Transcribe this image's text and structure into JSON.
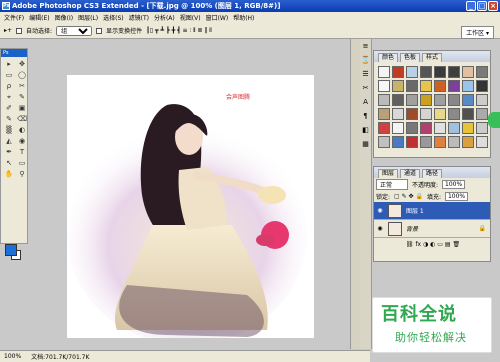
{
  "window": {
    "title": "Adobe Photoshop CS3 Extended - [下载.jpg @ 100% (图层 1, RGB/8#)]"
  },
  "menu": [
    "文件(F)",
    "编辑(E)",
    "图像(I)",
    "图层(L)",
    "选择(S)",
    "滤镜(T)",
    "分析(A)",
    "视图(V)",
    "窗口(W)",
    "帮助(H)"
  ],
  "options": {
    "auto_select": "自动选择:",
    "select_value": "组",
    "show_transform": "显示变换控件",
    "workspace": "工作区 ▾"
  },
  "toolbox": {
    "header": "Ps",
    "tools": [
      "▸",
      "✥",
      "▭",
      "◯",
      "ρ",
      "✂",
      "⌖",
      "✎",
      "✐",
      "▣",
      "✎",
      "⌫",
      "▒",
      "◐",
      "◭",
      "◉",
      "✒",
      "T",
      "↖",
      "▭",
      "✋",
      "⚲"
    ]
  },
  "canvas": {
    "watermark": "会声图腾"
  },
  "status": {
    "zoom": "100%",
    "doc": "文档:701.7K/701.7K"
  },
  "swatch_panel": {
    "tabs": [
      "颜色",
      "色板",
      "样式"
    ]
  },
  "swatch_colors": [
    "#f4f4f4",
    "#c23b22",
    "#b8d0e6",
    "#555",
    "#3a3a3a",
    "#3f3f3f",
    "#e0c0a0",
    "#7a7a7a",
    "#f7f7f7",
    "#c8b468",
    "#6a6a6a",
    "#e7c44a",
    "#d06020",
    "#7c3f9a",
    "#9ac4ea",
    "#333",
    "#bbbbbb",
    "#606060",
    "#a0a0a0",
    "#c9a020",
    "#9f9f9f",
    "#888",
    "#5a8ac6",
    "#cccccc",
    "#b9a078",
    "#d8d8d8",
    "#a04a2a",
    "#d4d4d4",
    "#e8d88a",
    "#8a8a8a",
    "#505050",
    "#aaaaaa",
    "#d04040",
    "#f3f3f3",
    "#777",
    "#b04070",
    "#e0e0e0",
    "#a0c0e0",
    "#e6c23a",
    "#cccccc",
    "#c0c0c0",
    "#4a7ac0",
    "#c03030",
    "#999",
    "#e08040",
    "#bbb",
    "#d8a040",
    "#ddd"
  ],
  "layers_panel": {
    "tabs": [
      "图层",
      "通道",
      "路径"
    ],
    "blend": "正常",
    "opacity_label": "不透明度:",
    "opacity": "100%",
    "lock_label": "锁定:",
    "fill_label": "填充:",
    "fill": "100%",
    "layers": [
      {
        "name": "图层 1",
        "selected": true
      },
      {
        "name": "背景",
        "selected": false
      }
    ]
  },
  "logo": {
    "big": "百科全说",
    "small": "助你轻松解决"
  }
}
